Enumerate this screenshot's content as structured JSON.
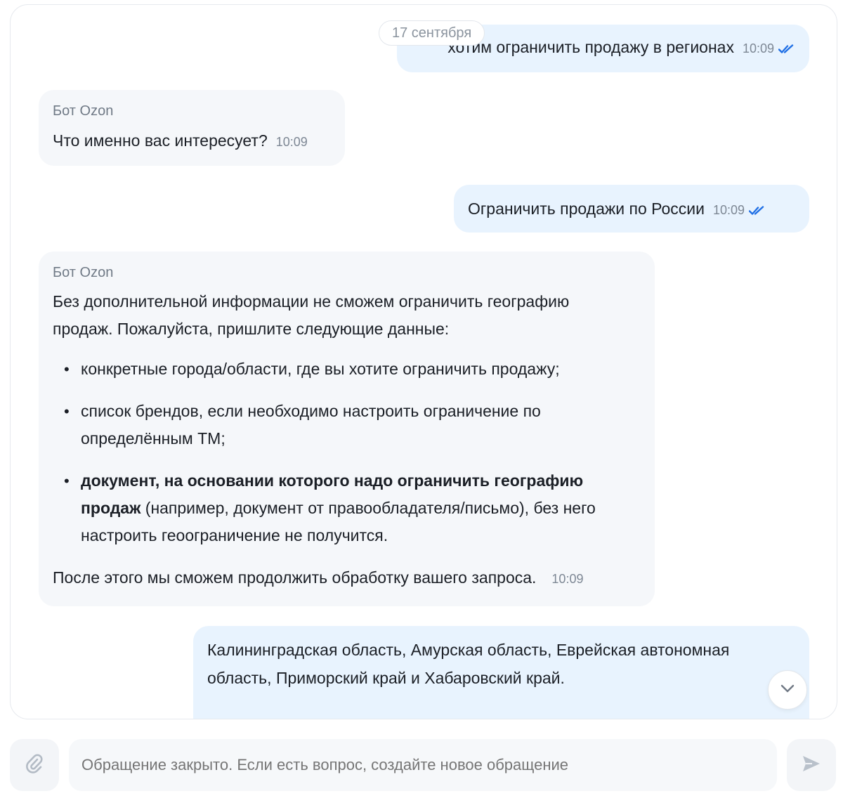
{
  "date_separator": "17 сентября",
  "colors": {
    "outgoing_bubble": "#e8f3fe",
    "incoming_bubble": "#f5f7fa",
    "check_marks": "#1f6fe5"
  },
  "messages": [
    {
      "direction": "outgoing",
      "text": "хотим ограничить продажу в регионах",
      "time": "10:09",
      "status_icon": "double-check-icon"
    },
    {
      "direction": "incoming",
      "sender": "Бот Ozon",
      "text": "Что именно вас интересует?",
      "time": "10:09"
    },
    {
      "direction": "outgoing",
      "text": "Ограничить продажи по России",
      "time": "10:09",
      "status_icon": "double-check-icon"
    },
    {
      "direction": "incoming",
      "sender": "Бот Ozon",
      "intro": "Без дополнительной информации не сможем ограничить географию продаж. Пожалуйста, пришлите следующие данные:",
      "bullets": [
        {
          "text": "конкретные города/области, где вы хотите ограничить продажу;"
        },
        {
          "text": "список брендов, если необходимо настроить ограничение по определённым ТМ;"
        },
        {
          "bold": "документ, на основании которого надо ограничить географию продаж",
          "text": " (например, документ от правообладателя/письмо), без него настроить геоограничение не получится."
        }
      ],
      "closing": "После этого мы сможем продолжить обработку вашего запроса.",
      "time": "10:09"
    },
    {
      "direction": "outgoing",
      "text": "Калининградская область, Амурская область, Еврейская автономная область, Приморский край и Хабаровский край."
    }
  ],
  "input": {
    "placeholder": "Обращение закрыто. Если есть вопрос, создайте новое обращение"
  }
}
